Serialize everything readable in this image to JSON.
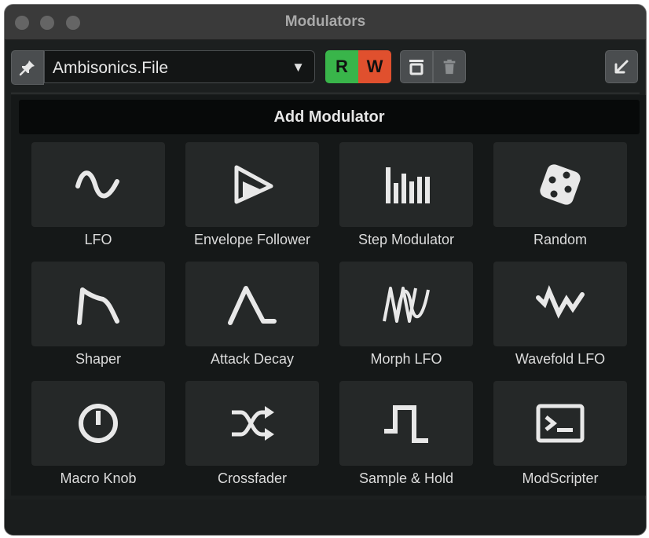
{
  "window": {
    "title": "Modulators"
  },
  "toolbar": {
    "preset_name": "Ambisonics.File",
    "read_label": "R",
    "write_label": "W"
  },
  "section": {
    "header": "Add Modulator"
  },
  "modulators": [
    {
      "label": "LFO",
      "icon": "sine-wave-icon"
    },
    {
      "label": "Envelope Follower",
      "icon": "envelope-follower-icon"
    },
    {
      "label": "Step Modulator",
      "icon": "step-bars-icon"
    },
    {
      "label": "Random",
      "icon": "dice-icon"
    },
    {
      "label": "Shaper",
      "icon": "shaper-curve-icon"
    },
    {
      "label": "Attack Decay",
      "icon": "attack-decay-icon"
    },
    {
      "label": "Morph LFO",
      "icon": "morph-wave-icon"
    },
    {
      "label": "Wavefold LFO",
      "icon": "wavefold-icon"
    },
    {
      "label": "Macro Knob",
      "icon": "knob-icon"
    },
    {
      "label": "Crossfader",
      "icon": "crossfade-shuffle-icon"
    },
    {
      "label": "Sample & Hold",
      "icon": "sample-hold-icon"
    },
    {
      "label": "ModScripter",
      "icon": "terminal-icon"
    }
  ],
  "colors": {
    "read_active": "#39b54a",
    "write_active": "#e0502e",
    "tile_bg": "#252828",
    "window_bg": "#1c1f1f"
  }
}
